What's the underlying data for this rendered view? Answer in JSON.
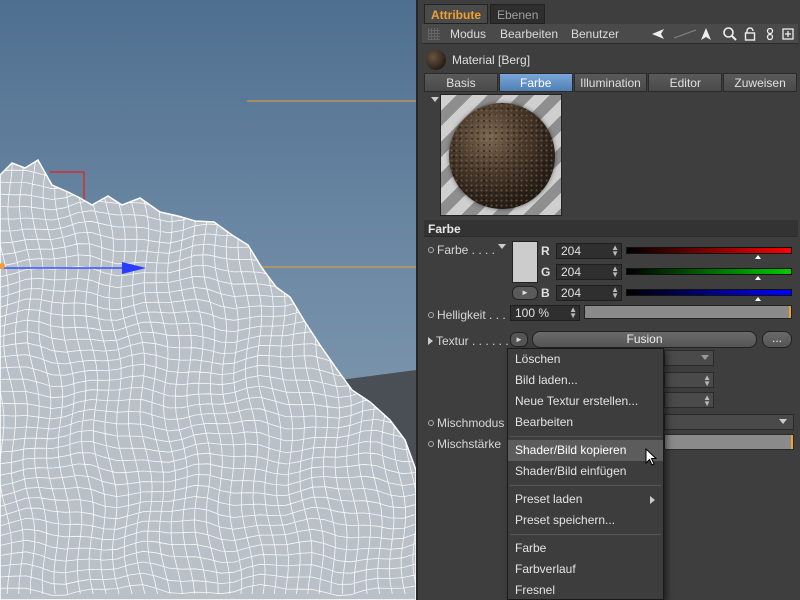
{
  "panel": {
    "tabs": [
      {
        "label": "Attribute",
        "active": true
      },
      {
        "label": "Ebenen",
        "active": false
      }
    ],
    "menubar": {
      "items": [
        "Modus",
        "Bearbeiten",
        "Benutzer"
      ],
      "icons": [
        "arrow-back-icon",
        "arrow-up-icon",
        "search-icon",
        "lock-icon",
        "pin-icon",
        "new-panel-icon"
      ]
    },
    "material": {
      "name": "Material [Berg]"
    },
    "subtabs": [
      {
        "label": "Basis",
        "active": false
      },
      {
        "label": "Farbe",
        "active": true
      },
      {
        "label": "Illumination",
        "active": false
      },
      {
        "label": "Editor",
        "active": false
      },
      {
        "label": "Zuweisen",
        "active": false
      }
    ],
    "section": {
      "title": "Farbe"
    },
    "farbe": {
      "label": "Farbe . . . .",
      "swatch_color": "#cccccc",
      "channels": [
        {
          "label": "R",
          "value": "204",
          "fraction": 0.8,
          "color": "#ff0000"
        },
        {
          "label": "G",
          "value": "204",
          "fraction": 0.8,
          "color": "#00cc00"
        },
        {
          "label": "B",
          "value": "204",
          "fraction": 0.8,
          "color": "#0000ff"
        }
      ]
    },
    "helligkeit": {
      "label": "Helligkeit . . .",
      "value": "100 %"
    },
    "textur": {
      "label": "Textur . . . . . .",
      "shader": "Fusion",
      "more": "..."
    },
    "mischmodus": {
      "label": "Mischmodus"
    },
    "mischstaerke": {
      "label": "Mischstärke"
    }
  },
  "context_menu": {
    "items": [
      {
        "label": "Löschen"
      },
      {
        "label": "Bild laden..."
      },
      {
        "label": "Neue Textur erstellen..."
      },
      {
        "label": "Bearbeiten"
      },
      {
        "label": "Shader/Bild kopieren",
        "highlighted": true
      },
      {
        "label": "Shader/Bild einfügen"
      },
      {
        "label": "Preset laden",
        "submenu": true
      },
      {
        "label": "Preset speichern..."
      },
      {
        "label": "Farbe"
      },
      {
        "label": "Farbverlauf"
      },
      {
        "label": "Fresnel"
      }
    ]
  },
  "colors": {
    "accent": "#f0a030",
    "active_tab": "#5b8bc4",
    "panel_bg": "#3e3e3e",
    "viewport_sky": "#6e8aa5"
  }
}
